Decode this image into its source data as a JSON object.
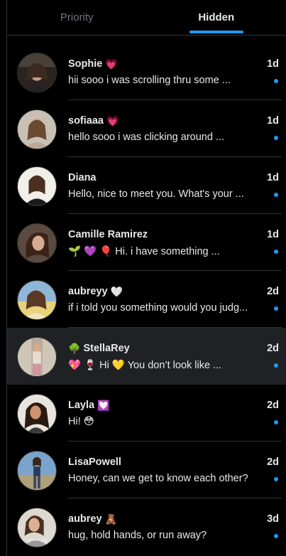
{
  "tabs": [
    {
      "label": "Priority",
      "active": false
    },
    {
      "label": "Hidden",
      "active": true
    }
  ],
  "accent_color": "#1d9bf0",
  "conversations": [
    {
      "name": "Sophie",
      "badge": "💗",
      "message": "hii sooo i was scrolling thru some ...",
      "time": "1d",
      "unread": true
    },
    {
      "name": "sofiaaa",
      "badge": "💗",
      "message": "hello sooo i was clicking around ...",
      "time": "1d",
      "unread": true
    },
    {
      "name": "Diana",
      "badge": "",
      "message": "Hello, nice to meet you. What's your ...",
      "time": "1d",
      "unread": true
    },
    {
      "name": "Camille Ramirez",
      "badge": "",
      "message": "🌱 💜 🎈 Hi. i have something ...",
      "time": "1d",
      "unread": true
    },
    {
      "name": "aubreyy",
      "badge": "🤍",
      "message": "if i told you something would you judg...",
      "time": "2d",
      "unread": true
    },
    {
      "name": "StellaRey",
      "badge_before": "🌳",
      "message": "💖 🍷 Hi 💛 You don’t look like ...",
      "time": "2d",
      "unread": true,
      "selected": true
    },
    {
      "name": "Layla",
      "badge": "💟",
      "message": "Hi!  😳",
      "time": "2d",
      "unread": true
    },
    {
      "name": "LisaPowell",
      "badge": "",
      "message": "Honey, can we get to know each other?",
      "time": "2d",
      "unread": true
    },
    {
      "name": "aubrey",
      "badge": "🧸",
      "message": "hug, hold hands, or run away?",
      "time": "3d",
      "unread": true
    }
  ]
}
